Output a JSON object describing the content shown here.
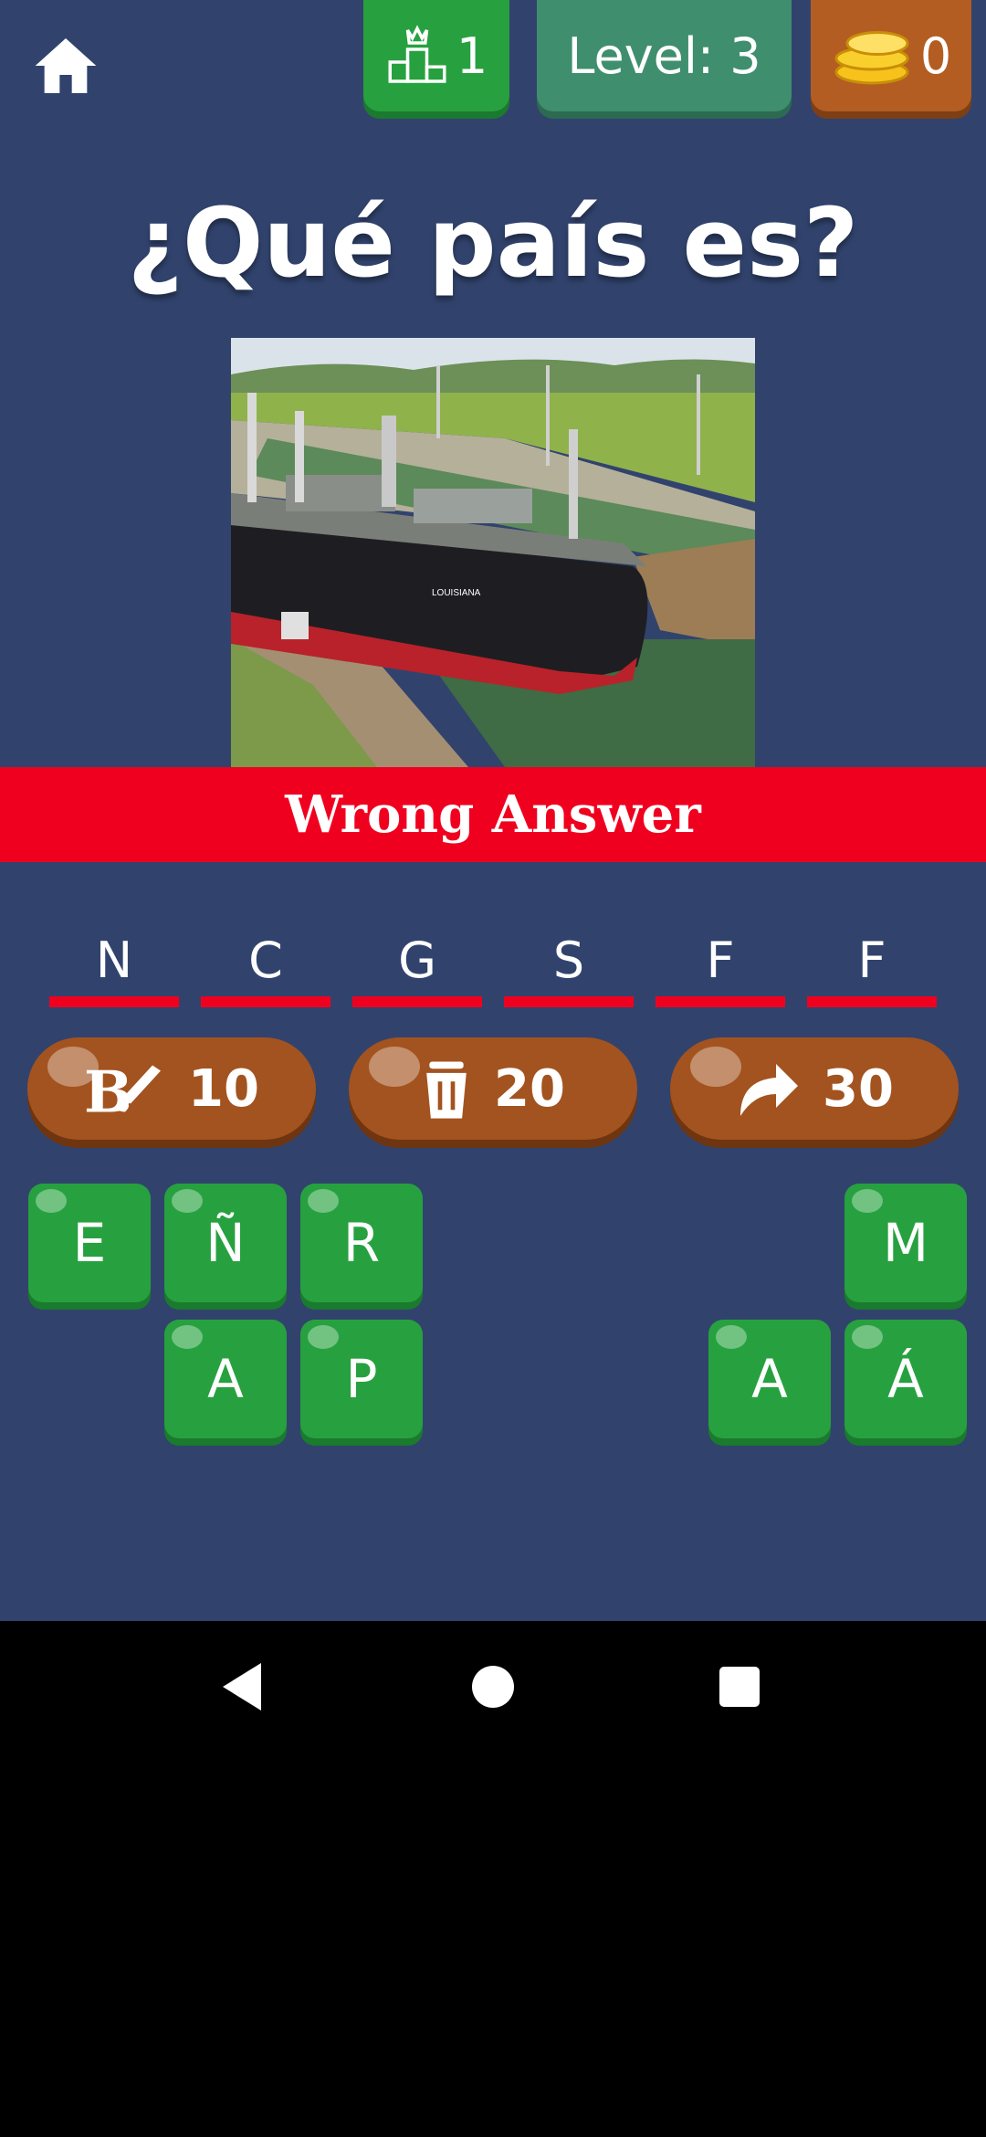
{
  "header": {
    "rank": "1",
    "level": "Level: 3",
    "coins": "0"
  },
  "title": "¿Qué país es?",
  "photo": {
    "description_icon": "ship-in-canal-photo"
  },
  "banner": "Wrong Answer",
  "answer_slots": [
    "N",
    "C",
    "G",
    "S",
    "F",
    "F"
  ],
  "hints": [
    {
      "icon": "paint-brush-icon",
      "cost": "10"
    },
    {
      "icon": "trash-icon",
      "cost": "20"
    },
    {
      "icon": "skip-arrow-icon",
      "cost": "30"
    }
  ],
  "letters": {
    "row1": [
      "E",
      "Ñ",
      "R",
      "M"
    ],
    "row2": [
      "A",
      "P",
      "A",
      "Á"
    ]
  },
  "colors": {
    "background": "#31436d",
    "green": "#27a13f",
    "red": "#f0001f",
    "brown": "#a3531f"
  }
}
